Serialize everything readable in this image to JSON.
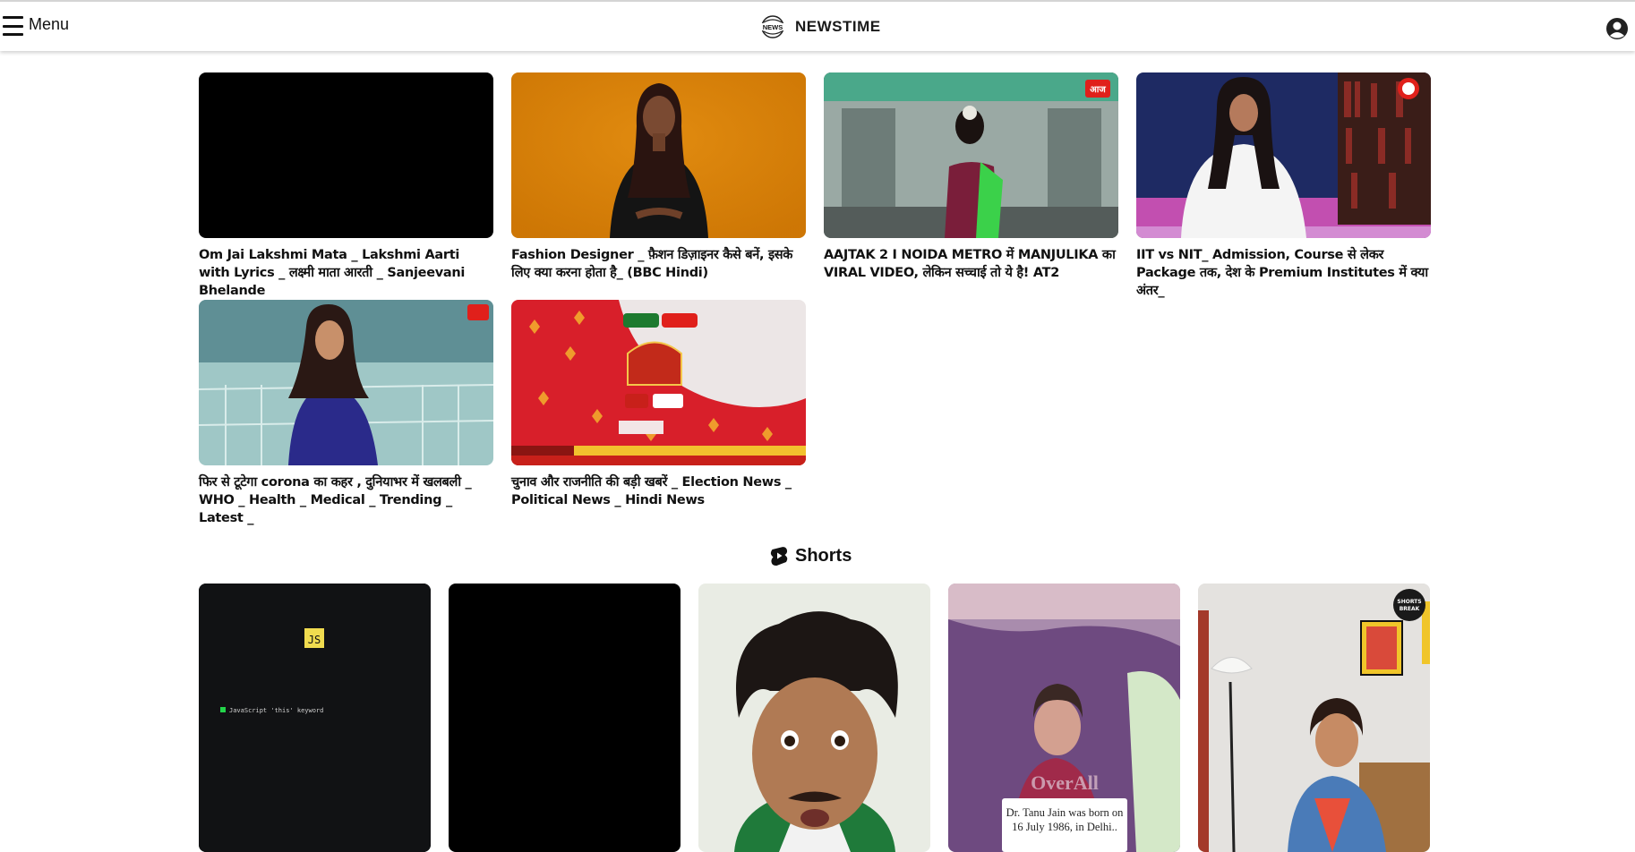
{
  "header": {
    "menu_label": "Menu",
    "brand_name": "NEWSTIME",
    "logo_text": "NEWS",
    "menu_icon": "hamburger-icon",
    "account_icon": "user-circle-icon"
  },
  "videos": [
    {
      "title": "Om Jai Lakshmi Mata _ Lakshmi Aarti with Lyrics _ लक्ष्मी माता आरती _ Sanjeevani Bhelande"
    },
    {
      "title": "Fashion Designer _ फ़ैशन डिज़ाइनर कैसे बनें, इसके लिए क्या करना होता है_ (BBC Hindi)"
    },
    {
      "title": "AAJTAK 2 I NOIDA METRO में MANJULIKA का VIRAL VIDEO, लेकिन सच्चाई तो ये है! AT2"
    },
    {
      "title": "IIT vs NIT_ Admission, Course से लेकर Package तक, देश के Premium Institutes में क्या अंतर_"
    },
    {
      "title": "फिर से टूटेगा corona का कहर , दुनियाभर में खलबली _ WHO _ Health _ Medical _ Trending _ Latest _"
    },
    {
      "title": "चुनाव और राजनीति की बड़ी खबरें _ Election News _ Political News _ Hindi News"
    }
  ],
  "shorts": {
    "heading": "Shorts",
    "icon": "shorts-icon",
    "items": [
      {
        "badge": "JS",
        "caption": "JavaScript 'this' keyword"
      },
      {},
      {},
      {
        "caption": "Dr. Tanu Jain was born on 16 July 1986, in Delhi..",
        "watermark": "OverAll"
      },
      {
        "badge": "SHORTS BREAK"
      }
    ]
  },
  "colors": {
    "orange_bg": "#d98007",
    "aajtak_red": "#e0201b",
    "js_yellow": "#f0db4f"
  }
}
